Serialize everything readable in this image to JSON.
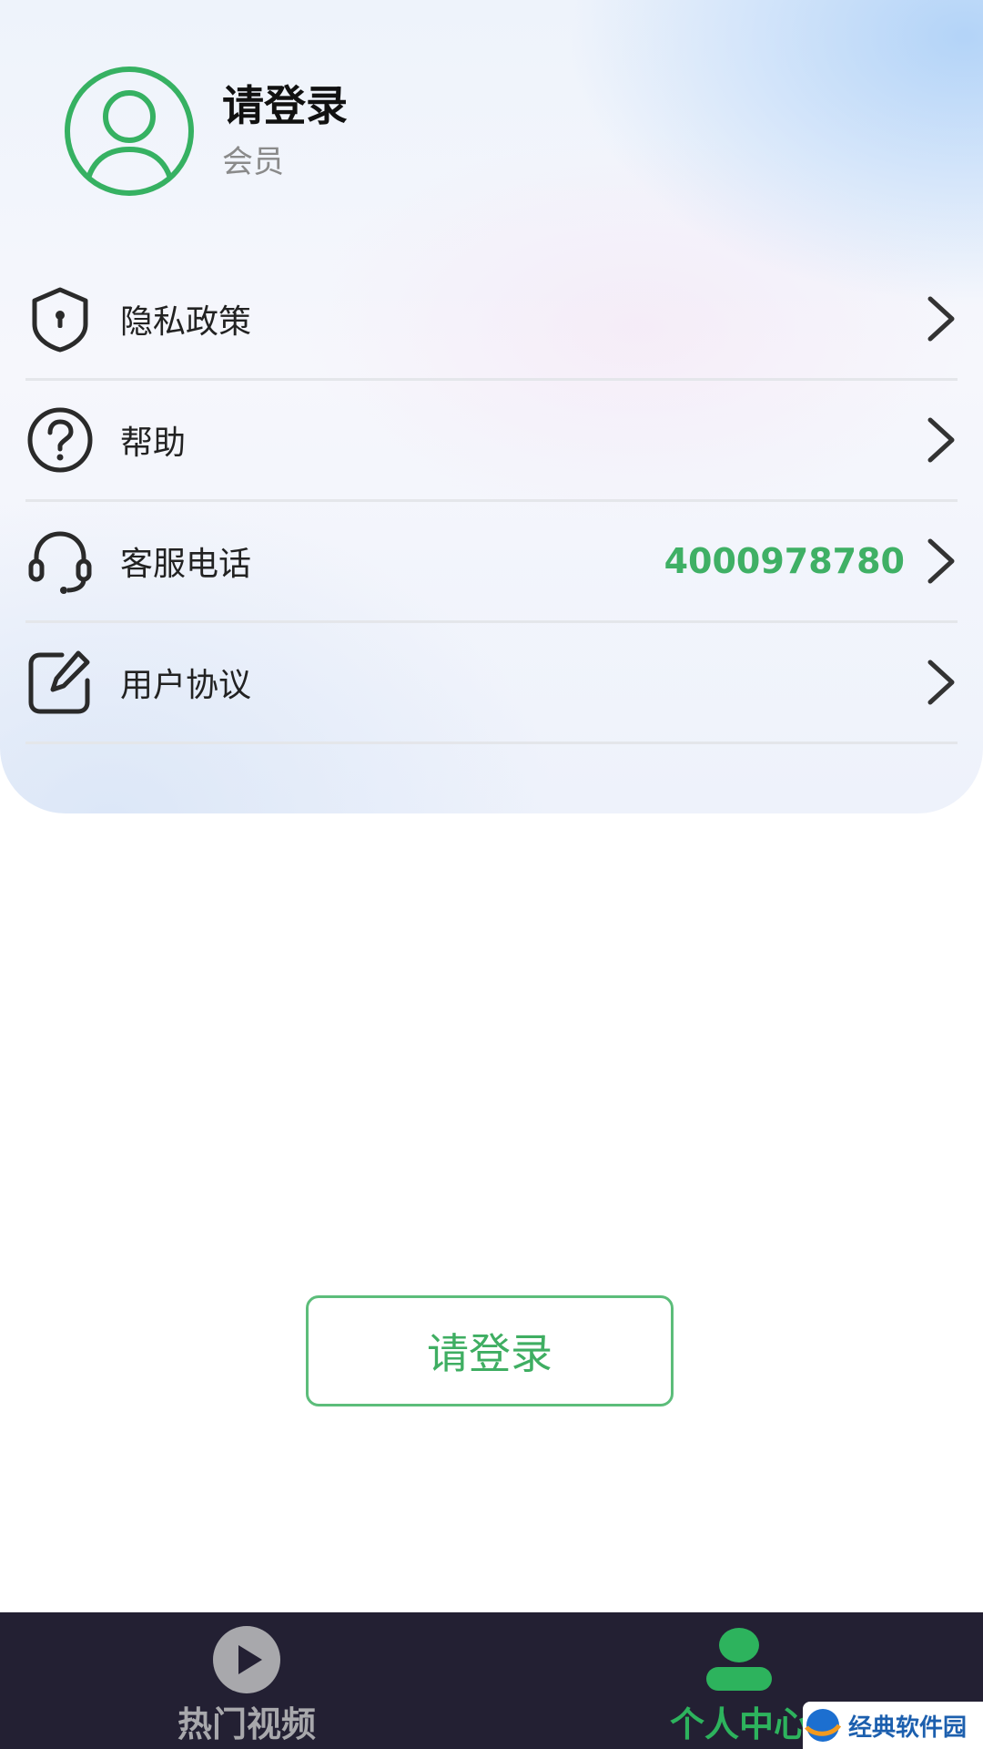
{
  "profile": {
    "title": "请登录",
    "subtitle": "会员"
  },
  "menu": [
    {
      "label": "隐私政策",
      "icon": "shield-lock-icon"
    },
    {
      "label": "帮助",
      "icon": "question-circle-icon"
    },
    {
      "label": "客服电话",
      "icon": "headset-icon",
      "value": "4000978780"
    },
    {
      "label": "用户协议",
      "icon": "edit-square-icon"
    }
  ],
  "login_button": {
    "label": "请登录"
  },
  "tabbar": {
    "tabs": [
      {
        "label": "热门视频",
        "icon": "play-circle-icon",
        "active": false
      },
      {
        "label": "个人中心",
        "icon": "user-icon",
        "active": true
      }
    ]
  },
  "watermark": {
    "text": "经典软件园"
  },
  "colors": {
    "accent": "#3fb065",
    "tabbar_bg": "#232033",
    "inactive_tab": "#a8a8ac"
  }
}
